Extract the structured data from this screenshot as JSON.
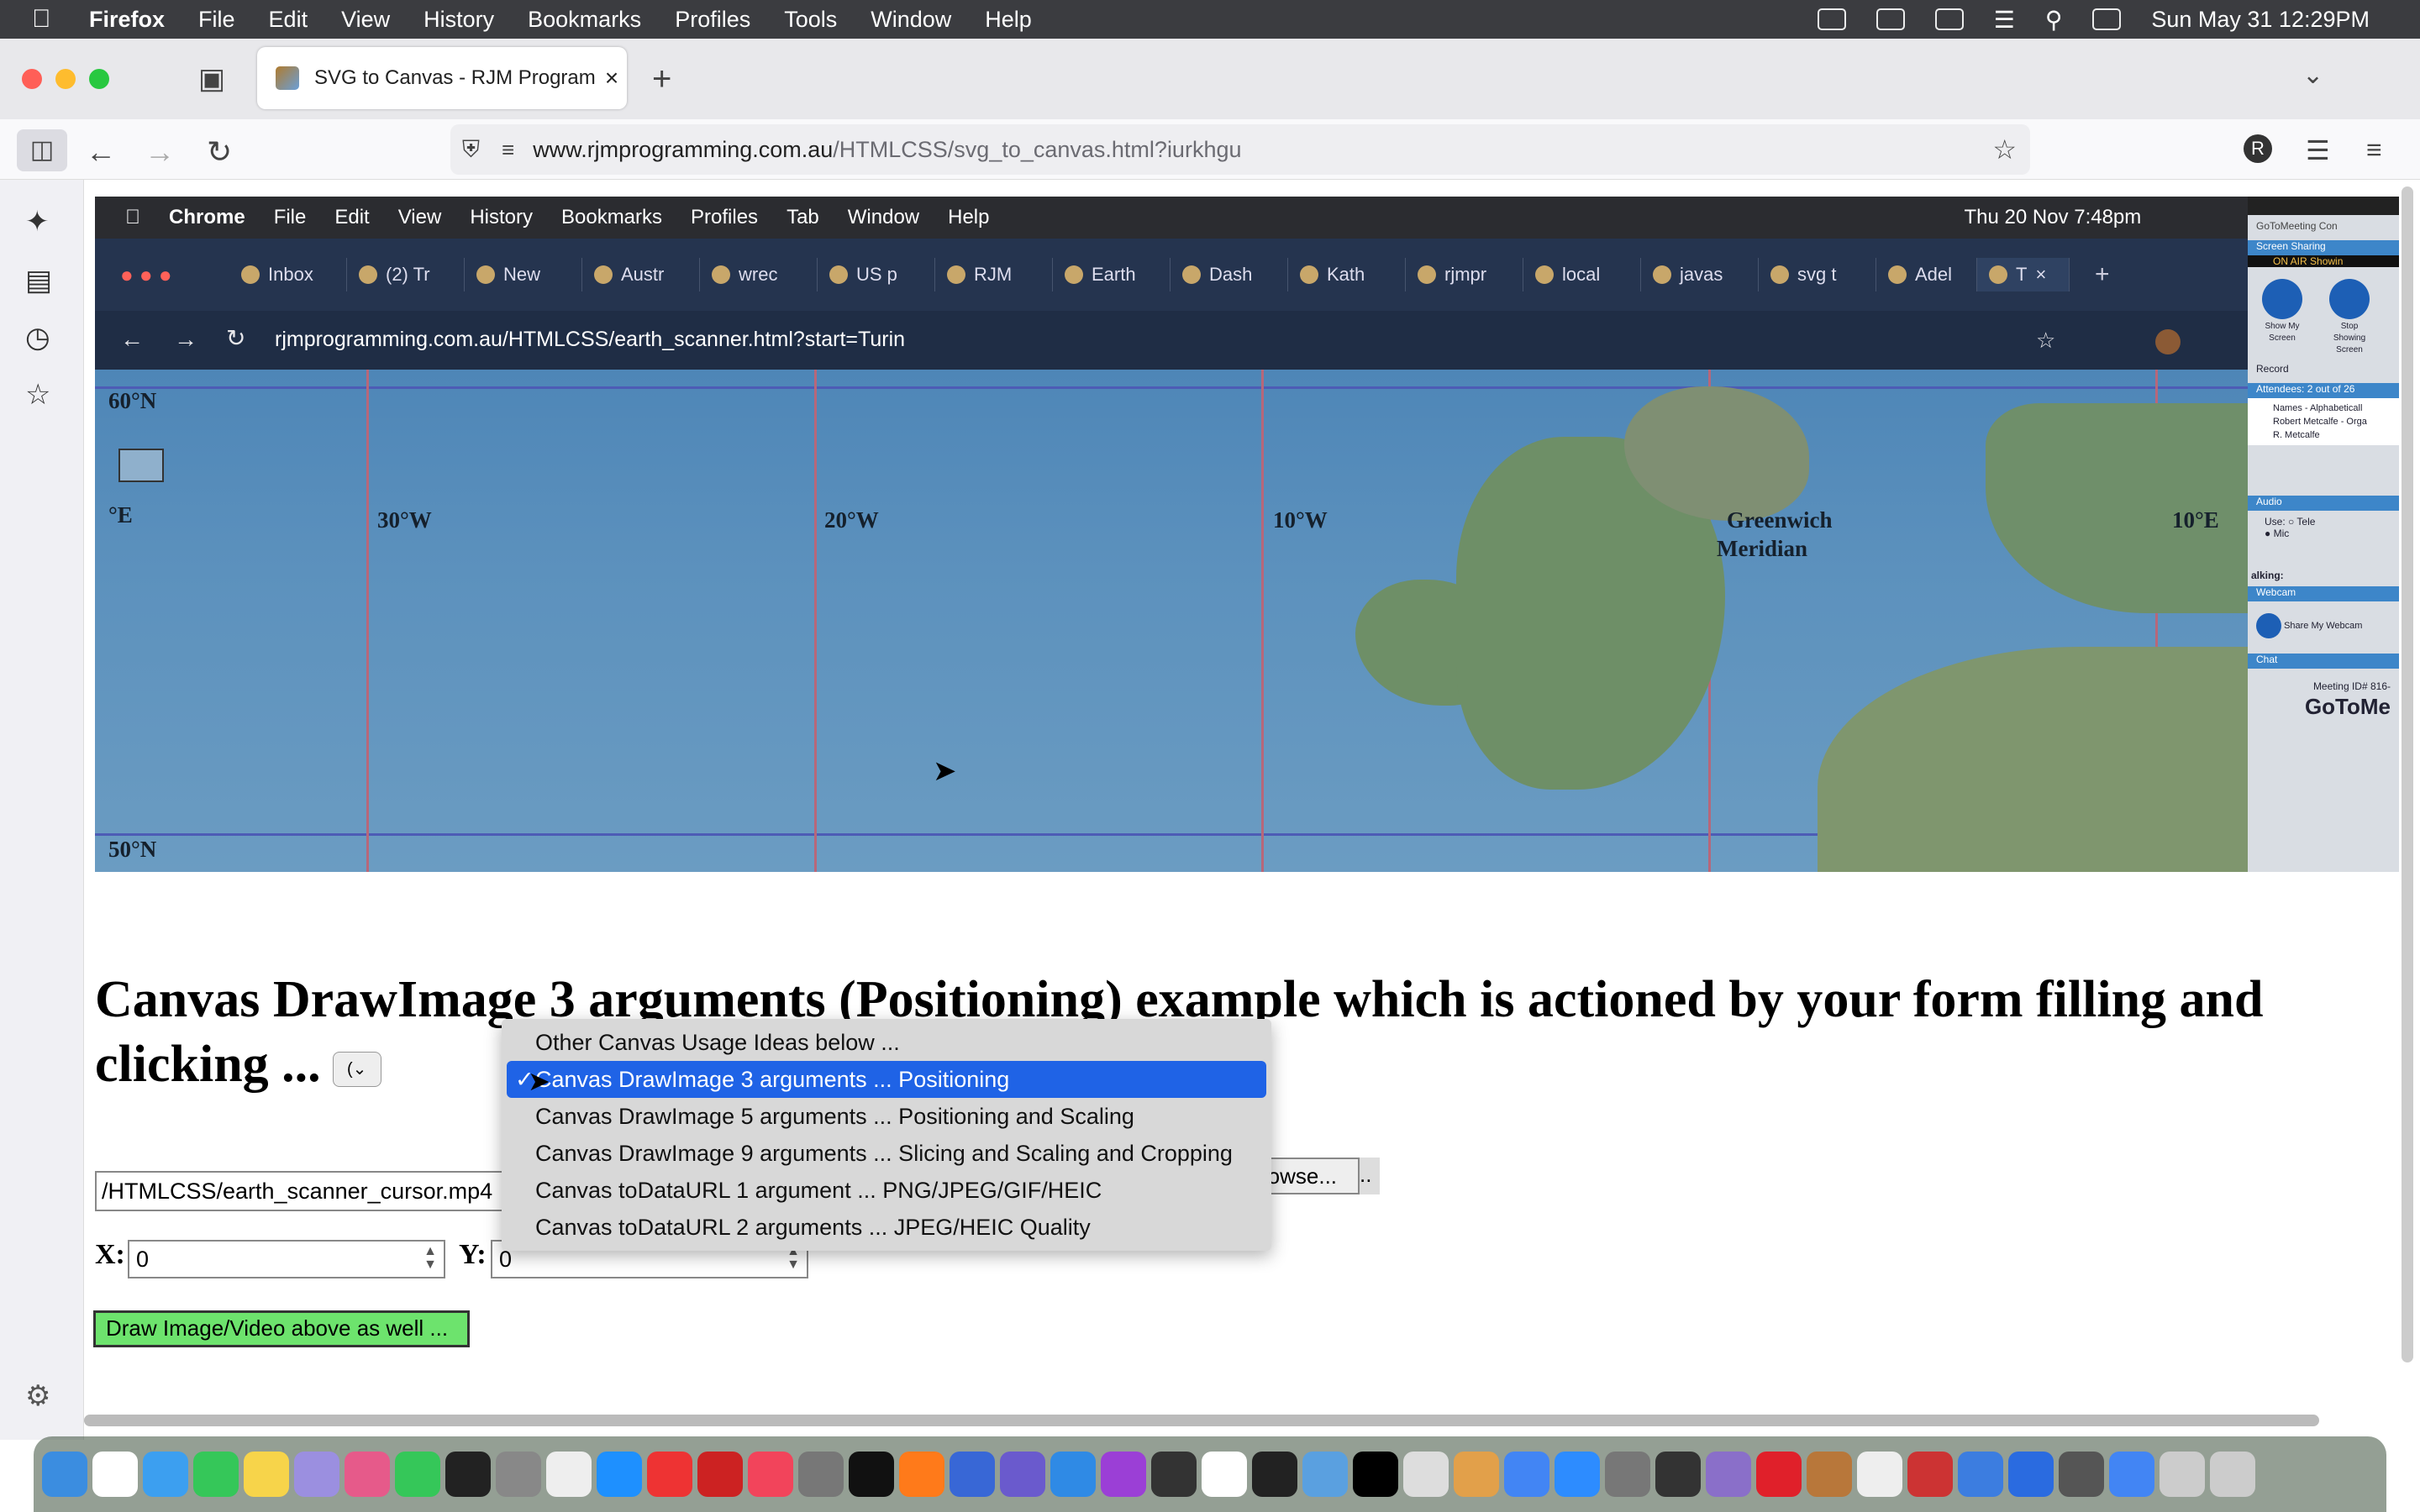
{
  "system_menubar": {
    "app": "Firefox",
    "items": [
      "File",
      "Edit",
      "View",
      "History",
      "Bookmarks",
      "Profiles",
      "Tools",
      "Window",
      "Help"
    ],
    "clock": "Sun May 31  12:29PM"
  },
  "browser": {
    "tab_title": "SVG to Canvas - RJM Programm",
    "url_host": "www.rjmprogramming.com.au",
    "url_path": "/HTMLCSS/svg_to_canvas.html?iurkhgu",
    "profile_initial": "R"
  },
  "embedded_screenshot": {
    "menubar": {
      "app": "Chrome",
      "items": [
        "File",
        "Edit",
        "View",
        "History",
        "Bookmarks",
        "Profiles",
        "Tab",
        "Window",
        "Help"
      ],
      "clock": "Thu 20 Nov  7:48pm"
    },
    "tabs": [
      "Inbox",
      "(2) Tr",
      "New",
      "Austr",
      "wrec",
      "US p",
      "RJM",
      "Earth",
      "Dash",
      "Kath",
      "rjmpr",
      "local",
      "javas",
      "svg t",
      "Adel",
      "T"
    ],
    "address": "rjmprogramming.com.au/HTMLCSS/earth_scanner.html?start=Turin",
    "map_labels": {
      "lat_top": "60°N",
      "lat_bottom": "50°N",
      "east_edge": "°E",
      "w30": "30°W",
      "w20": "20°W",
      "w10": "10°W",
      "greenwich": "Greenwich",
      "meridian": "Meridian",
      "e10": "10°E"
    },
    "gotomeeting": {
      "title": "GoToMeeting Con",
      "screen_sharing": "Screen Sharing",
      "on_air": "ON AIR  Showin",
      "show_my_screen": "Show My Screen",
      "stop_showing": "Stop Showing Screen",
      "record": "Record",
      "attendees": "Attendees: 2 out of 26",
      "names": [
        "Names - Alphabeticall",
        "Robert Metcalfe - Orga",
        "R. Metcalfe"
      ],
      "audio": "Audio",
      "use_label": "Use:",
      "tele": "Tele",
      "mic": "Mic",
      "talking": "alking:",
      "webcam": "Webcam",
      "share_webcam": "Share My Webcam",
      "chat": "Chat",
      "meeting_id": "Meeting ID# 816-",
      "brand": "GoToMe"
    }
  },
  "page": {
    "heading": "Canvas DrawImage 3 arguments (Positioning) example which is actioned by your form filling and clicking ...",
    "mini_select_value": "(",
    "dropdown_options": [
      "Other Canvas Usage Ideas below ...",
      "Canvas DrawImage 3 arguments ... Positioning",
      "Canvas DrawImage 5 arguments ... Positioning and Scaling",
      "Canvas DrawImage 9 arguments ... Slicing and Scaling and Cropping",
      "Canvas toDataURL 1 argument ... PNG/JPEG/GIF/HEIC",
      "Canvas toDataURL 2 arguments ... JPEG/HEIC Quality"
    ],
    "selected_option_index": 1,
    "file_value": "/HTMLCSS/earth_scanner_cursor.mp4",
    "browse_label": "rowse...",
    "more_label": "..",
    "x_label": "X:",
    "x_value": "0",
    "y_label": "Y:",
    "y_value": "0",
    "draw_button": "Draw Image/Video above as well ..."
  },
  "colors": {
    "selected_option": "#1f63e6",
    "draw_button": "#6de36d"
  }
}
